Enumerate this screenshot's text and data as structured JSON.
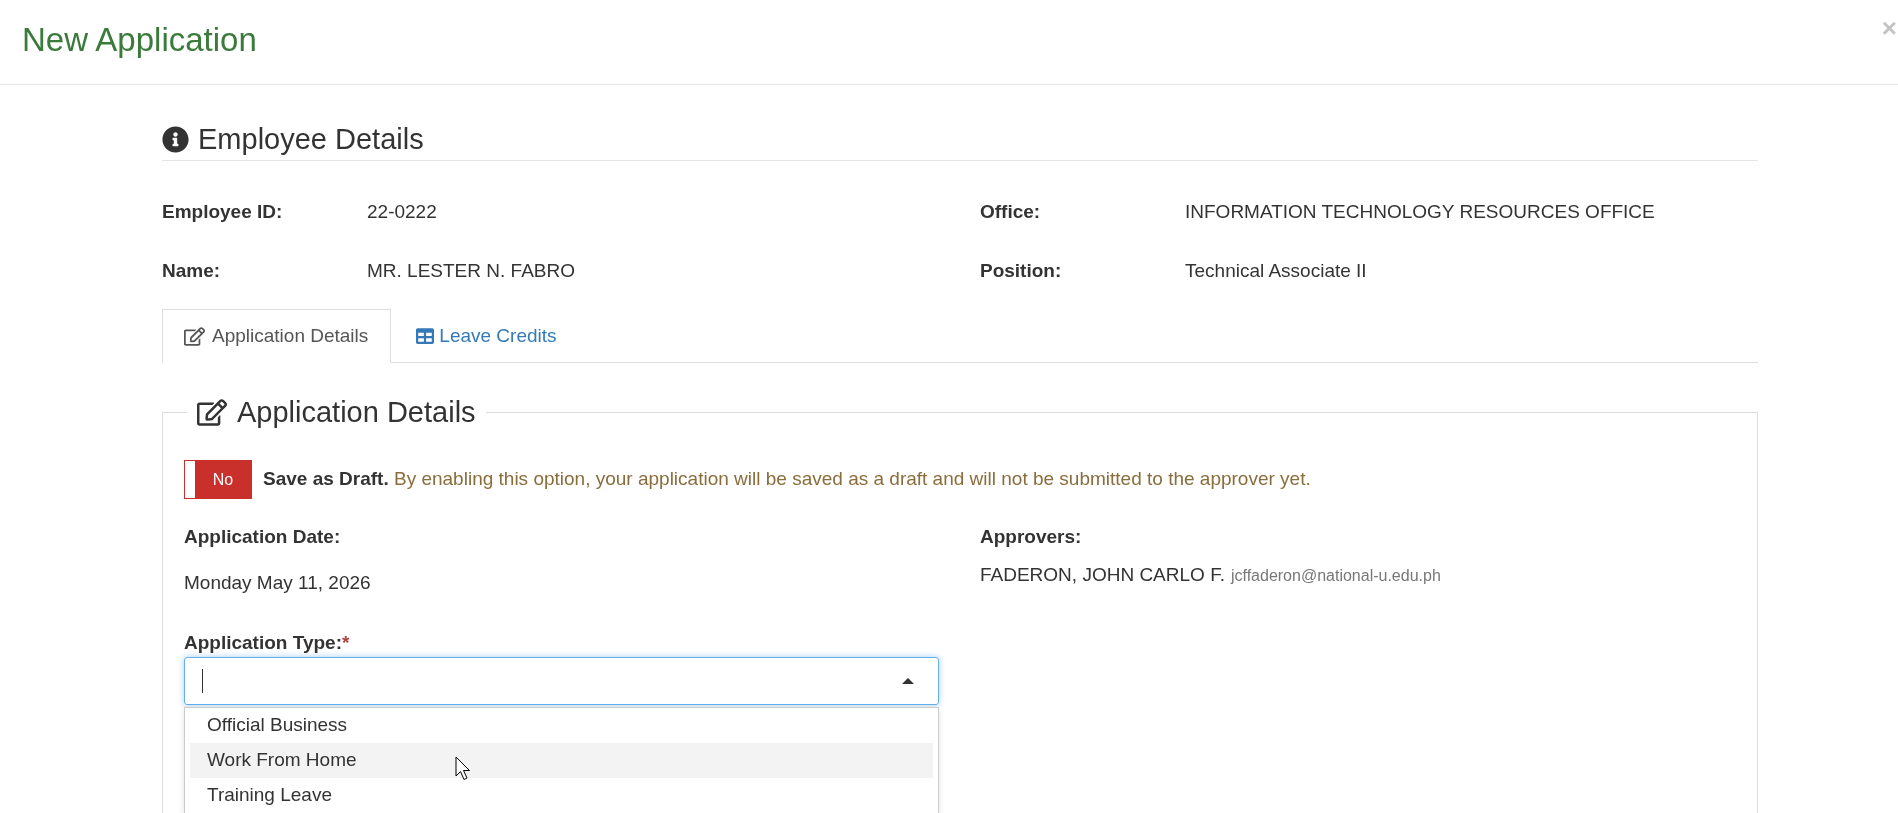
{
  "modal": {
    "title": "New Application",
    "close_label": "×"
  },
  "employee_details": {
    "heading": "Employee Details",
    "fields": [
      {
        "label": "Employee ID:",
        "value": "22-0222"
      },
      {
        "label": "Office:",
        "value": "INFORMATION TECHNOLOGY RESOURCES OFFICE"
      },
      {
        "label": "Name:",
        "value": "MR. LESTER N. FABRO"
      },
      {
        "label": "Position:",
        "value": "Technical Associate II"
      }
    ]
  },
  "tabs": [
    {
      "label": "Application Details",
      "selected": true
    },
    {
      "label": "Leave Credits",
      "selected": false
    }
  ],
  "application_details": {
    "legend": "Application Details",
    "save_as_draft": {
      "on": false,
      "state_label": "No",
      "text": "**Save as Draft.** By enabling this option, your application will be saved as a draft and will not be submitted to the approver yet."
    },
    "application_date": {
      "label": "Application Date:",
      "value": "Monday May 11, 2026"
    },
    "approvers": {
      "label": "Approvers:",
      "items": [
        {
          "name": "FADERON, JOHN CARLO F.",
          "email": "jcffaderon@national-u.edu.ph"
        }
      ]
    },
    "application_type": {
      "label": "Application Type:",
      "required_mark": "*",
      "focused": true,
      "expanded": true,
      "options": [
        {
          "label": "Official Business",
          "highlighted": false
        },
        {
          "label": "Work From Home",
          "highlighted": true
        },
        {
          "label": "Training Leave",
          "highlighted": false
        }
      ]
    }
  }
}
